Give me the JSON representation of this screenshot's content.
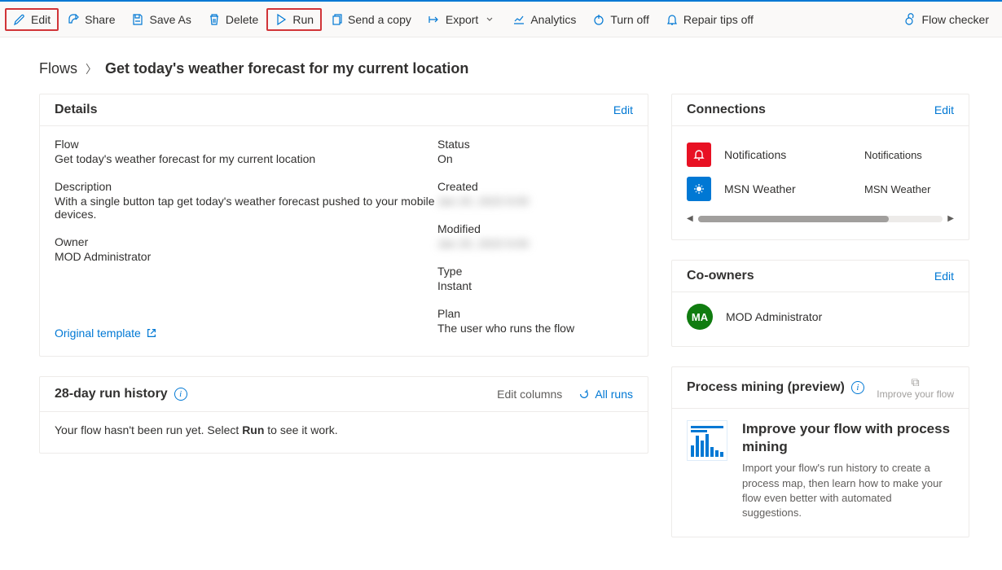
{
  "toolbar": {
    "edit": "Edit",
    "share": "Share",
    "save_as": "Save As",
    "delete": "Delete",
    "run": "Run",
    "send_copy": "Send a copy",
    "export": "Export",
    "analytics": "Analytics",
    "turn_off": "Turn off",
    "repair_tips": "Repair tips off",
    "flow_checker": "Flow checker"
  },
  "breadcrumb": {
    "root": "Flows",
    "current": "Get today's weather forecast for my current location"
  },
  "details": {
    "title": "Details",
    "edit": "Edit",
    "flow_label": "Flow",
    "flow_name": "Get today's weather forecast for my current location",
    "description_label": "Description",
    "description": "With a single button tap get today's weather forecast pushed to your mobile devices.",
    "owner_label": "Owner",
    "owner": "MOD Administrator",
    "status_label": "Status",
    "status": "On",
    "created_label": "Created",
    "created": "Jan 20, 2023 9:00",
    "modified_label": "Modified",
    "modified": "Jan 20, 2023 9:00",
    "type_label": "Type",
    "type": "Instant",
    "plan_label": "Plan",
    "plan": "The user who runs the flow",
    "original_template": "Original template"
  },
  "history": {
    "title": "28-day run history",
    "edit_columns": "Edit columns",
    "all_runs": "All runs",
    "empty_prefix": "Your flow hasn't been run yet. Select ",
    "empty_bold": "Run",
    "empty_suffix": " to see it work."
  },
  "connections": {
    "title": "Connections",
    "edit": "Edit",
    "items": [
      {
        "name": "Notifications",
        "sub": "Notifications"
      },
      {
        "name": "MSN Weather",
        "sub": "MSN Weather"
      }
    ]
  },
  "coowners": {
    "title": "Co-owners",
    "edit": "Edit",
    "avatar": "MA",
    "name": "MOD Administrator"
  },
  "process_mining": {
    "title": "Process mining (preview)",
    "action": "Improve your flow",
    "heading": "Improve your flow with process mining",
    "body": "Import your flow's run history to create a process map, then learn how to make your flow even better with automated suggestions."
  }
}
